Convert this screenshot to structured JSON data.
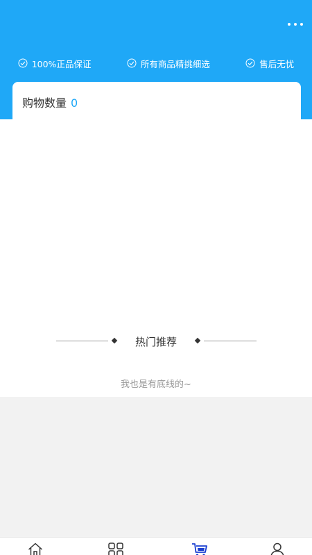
{
  "header": {
    "background_color": "#1fa8f7",
    "more_icon": "more-icon",
    "guarantees": [
      {
        "label": "100%正品保证",
        "icon": "check-circle-icon"
      },
      {
        "label": "所有商品精挑细选",
        "icon": "check-circle-icon"
      },
      {
        "label": "售后无忧",
        "icon": "check-circle-icon"
      }
    ]
  },
  "cart": {
    "count_label": "购物数量",
    "count_value": "0",
    "accent_color": "#1fa8f7"
  },
  "recommend": {
    "title": "热门推荐"
  },
  "footer_note": "我也是有底线的~",
  "tabbar": {
    "items": [
      {
        "icon": "home-icon"
      },
      {
        "icon": "category-icon"
      },
      {
        "icon": "cart-icon",
        "active": true
      },
      {
        "icon": "user-icon"
      }
    ],
    "active_color": "#1a3fd1"
  }
}
